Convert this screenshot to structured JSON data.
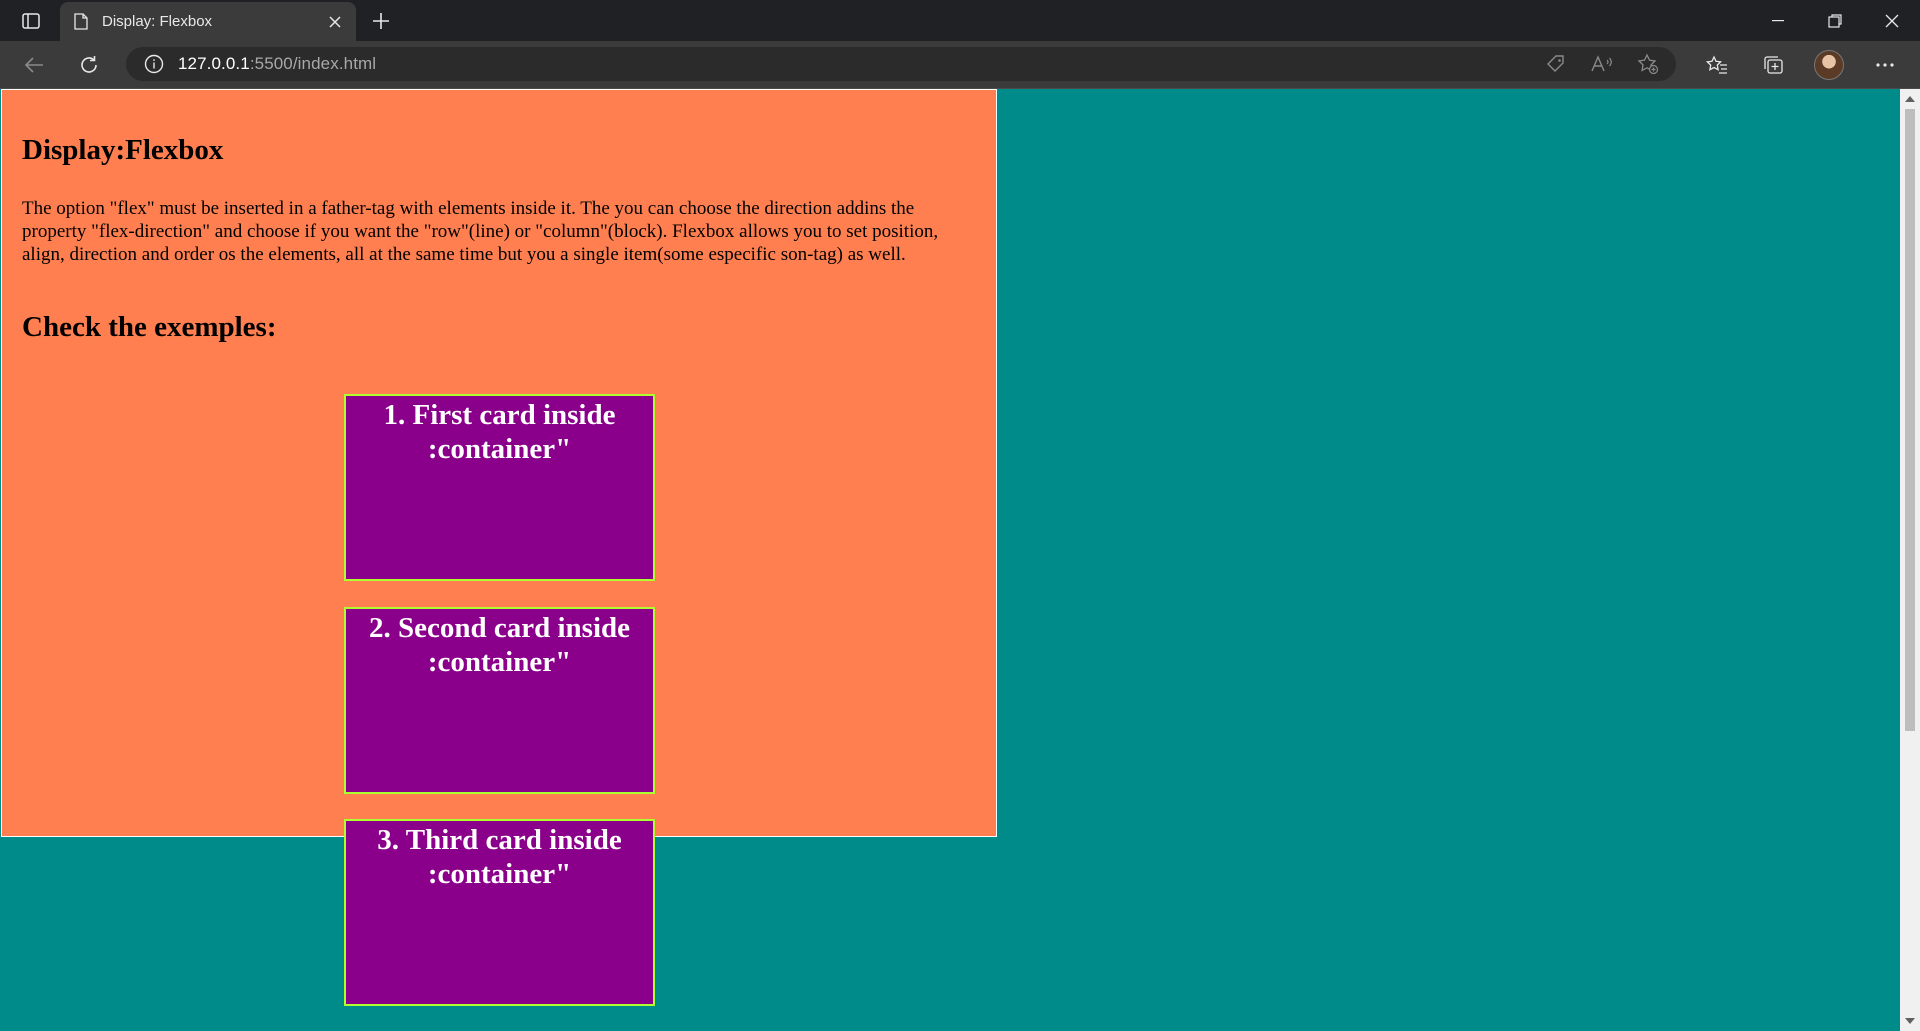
{
  "browser": {
    "tab_title": "Display: Flexbox",
    "url_host": "127.0.0.1",
    "url_rest": ":5500/index.html"
  },
  "page": {
    "heading": "Display:Flexbox",
    "description": "The option \"flex\" must be inserted in a father-tag with elements inside it. The you can choose the direction addins the property \"flex-direction\" and choose if you want the \"row\"(line) or \"column\"(block). Flexbox allows you to set position, align, direction and order os the elements, all at the same time but you a single item(some especific son-tag) as well.",
    "subheading": "Check the exemples:",
    "cards": [
      {
        "label": "1. First card inside :container\""
      },
      {
        "label": "2. Second card inside :container\""
      },
      {
        "label": "3. Third card inside :container\""
      }
    ]
  },
  "colors": {
    "page_background": "#008b8b",
    "container_background": "#ff7f50",
    "card_background": "#8b008b",
    "card_border": "#adff2f"
  }
}
